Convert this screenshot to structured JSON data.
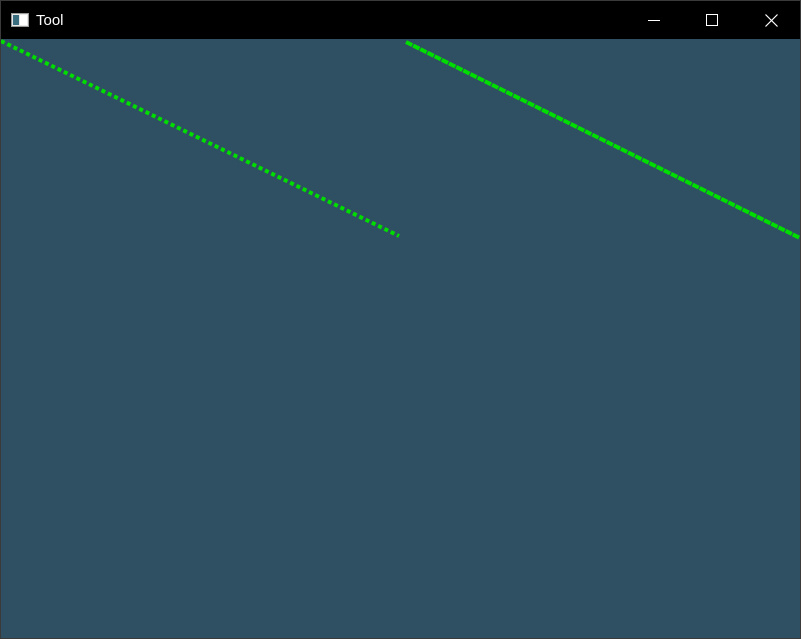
{
  "window": {
    "title": "Tool",
    "background_color": "#2f5062",
    "titlebar_color": "#000000"
  },
  "titlebar": {
    "app_icon": "window-app-icon",
    "buttons": [
      {
        "name": "minimize",
        "icon": "minimize-icon"
      },
      {
        "name": "maximize",
        "icon": "maximize-icon"
      },
      {
        "name": "close",
        "icon": "close-icon"
      }
    ]
  },
  "canvas": {
    "line_color": "#00dd00",
    "lines": [
      {
        "name": "line-left",
        "style": "dotted"
      },
      {
        "name": "line-right",
        "style": "dashed"
      }
    ]
  }
}
